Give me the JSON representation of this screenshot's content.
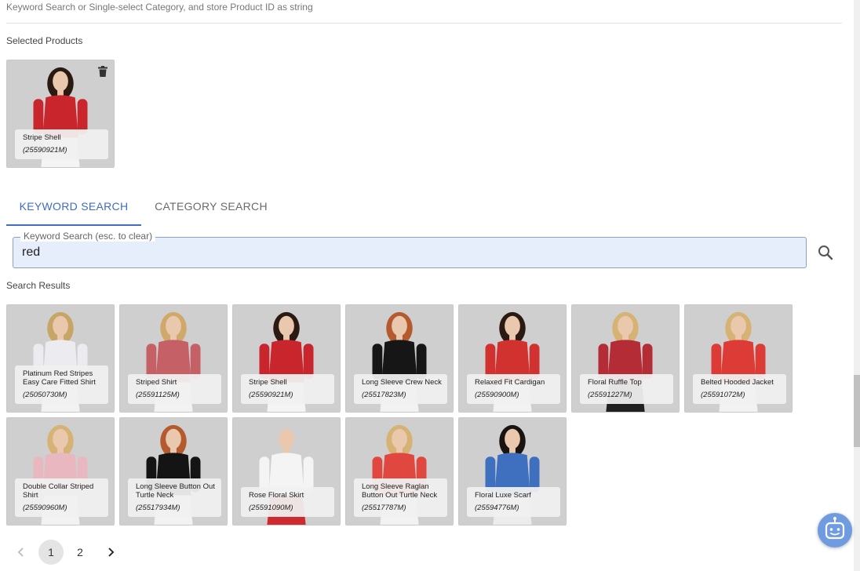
{
  "header": {
    "description": "Keyword Search or Single-select Category, and store Product ID as string"
  },
  "selected": {
    "label": "Selected Products",
    "items": [
      {
        "name": "Stripe Shell",
        "id": "(25590921M)",
        "bg": "#cfcfcf",
        "top": "#c8252c",
        "bottom": "#f4f4f4",
        "hair": "#2a1a12"
      }
    ]
  },
  "tabs": [
    {
      "label": "KEYWORD SEARCH",
      "active": true
    },
    {
      "label": "CATEGORY SEARCH",
      "active": false
    }
  ],
  "search": {
    "legend": "Keyword Search (esc. to clear)",
    "value": "red"
  },
  "results": {
    "label": "Search Results",
    "items": [
      {
        "name": "Platinum Red Stripes Easy Care Fitted Shirt",
        "id": "(25050730M)",
        "bg": "#cfcfcf",
        "top": "#ebebf0",
        "bottom": "#f2f2f2",
        "hair": "#c7a567"
      },
      {
        "name": "Striped Shirt",
        "id": "(25591125M)",
        "bg": "#cfcfcf",
        "top": "#c46066",
        "bottom": "#f2f2f2",
        "hair": "#cfa969"
      },
      {
        "name": "Stripe Shell",
        "id": "(25590921M)",
        "bg": "#cfcfcf",
        "top": "#c8252c",
        "bottom": "#f4f4f4",
        "hair": "#2a1a12"
      },
      {
        "name": "Long Sleeve Crew Neck",
        "id": "(25517823M)",
        "bg": "#cfcfcf",
        "top": "#161616",
        "bottom": "#f2f2f2",
        "hair": "#b55a2e"
      },
      {
        "name": "Relaxed Fit Cardigan",
        "id": "(25590900M)",
        "bg": "#cfcfcf",
        "top": "#d1312f",
        "bottom": "#f2f2f2",
        "hair": "#2a1a12"
      },
      {
        "name": "Floral Ruffle Top",
        "id": "(25591227M)",
        "bg": "#cfcfcf",
        "top": "#b42c36",
        "bottom": "#202020",
        "hair": "#d6b274"
      },
      {
        "name": "Belted Hooded Jacket",
        "id": "(25591072M)",
        "bg": "#cfcfcf",
        "top": "#dd3b35",
        "bottom": "#f2f2f2",
        "hair": "#d6b274"
      },
      {
        "name": "Double Collar Striped Shirt",
        "id": "(25590960M)",
        "bg": "#cfcfcf",
        "top": "#e8b7c0",
        "bottom": "#f2f2f2",
        "hair": "#d6b274"
      },
      {
        "name": "Long Sleeve Button Out Turtle Neck",
        "id": "(25517934M)",
        "bg": "#cfcfcf",
        "top": "#141414",
        "bottom": "#f2f2f2",
        "hair": "#b55a2e"
      },
      {
        "name": "Rose Floral Skirt",
        "id": "(25591090M)",
        "bg": "#cfcfcf",
        "top": "#f4f4f4",
        "bottom": "#cf2a2f",
        "hair": "#cfcfcf"
      },
      {
        "name": "Long Sleeve Raglan Button Out Turtle Neck",
        "id": "(25517787M)",
        "bg": "#cfcfcf",
        "top": "#e0483f",
        "bottom": "#f2f2f2",
        "hair": "#d6b274"
      },
      {
        "name": "Floral Luxe Scarf",
        "id": "(25594776M)",
        "bg": "#cfcfcf",
        "top": "#3f6fbf",
        "bottom": "#ececec",
        "hair": "#1a1410"
      }
    ]
  },
  "pagination": {
    "pages": [
      "1",
      "2"
    ],
    "current": "1"
  },
  "icons": {
    "trash": "trash-icon",
    "search": "search-icon",
    "prev": "chevron-left-icon",
    "next": "chevron-right-icon",
    "assistant": "chat-bot-icon"
  },
  "colors": {
    "accent": "#3f6cc4",
    "search_bg": "#e7eefb",
    "assistant": "#6f9be0"
  }
}
